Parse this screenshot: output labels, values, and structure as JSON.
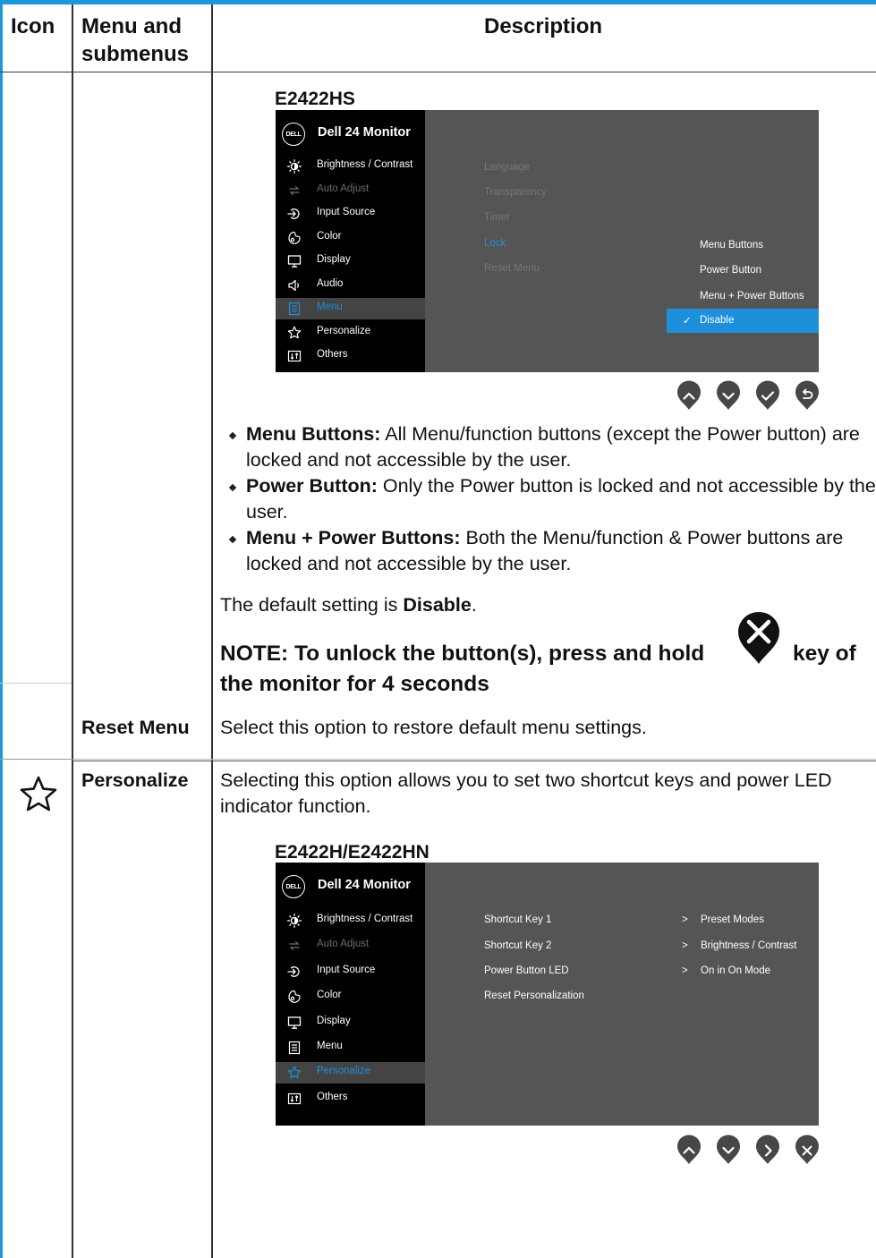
{
  "table": {
    "headers": {
      "icon": "Icon",
      "menu": "Menu and\nsubmenus",
      "description": "Description"
    }
  },
  "lock_row": {
    "osd": {
      "model_label": "E2422HS",
      "monitor_title": "Dell 24 Monitor",
      "logo_text": "DELL",
      "menu_items": [
        {
          "icon": "brightness-icon",
          "label": "Brightness / Contrast",
          "state": "normal"
        },
        {
          "icon": "auto-adjust-icon",
          "label": "Auto Adjust",
          "state": "dim"
        },
        {
          "icon": "input-source-icon",
          "label": "Input Source",
          "state": "normal"
        },
        {
          "icon": "color-icon",
          "label": "Color",
          "state": "normal"
        },
        {
          "icon": "display-icon",
          "label": "Display",
          "state": "normal"
        },
        {
          "icon": "audio-icon",
          "label": "Audio",
          "state": "normal"
        },
        {
          "icon": "menu-icon",
          "label": "Menu",
          "state": "selected"
        },
        {
          "icon": "personalize-icon",
          "label": "Personalize",
          "state": "normal"
        },
        {
          "icon": "others-icon",
          "label": "Others",
          "state": "normal"
        }
      ],
      "submenu": [
        "Language",
        "Transparency",
        "Timer",
        "Lock",
        "Reset Menu"
      ],
      "options": [
        "Menu Buttons",
        "Power Button",
        "Menu + Power Buttons",
        "Disable"
      ],
      "selected_check": "✓",
      "nav_buttons": [
        "up-icon",
        "down-icon",
        "check-icon",
        "back-icon"
      ]
    },
    "bullets": [
      {
        "term": "Menu Buttons:",
        "text": " All Menu/function buttons (except the Power button) are locked and not accessible by the user."
      },
      {
        "term": "Power Button:",
        "text": " Only the Power button is locked and not accessible by the user."
      },
      {
        "term": "Menu + Power Buttons:",
        "text": " Both the Menu/function & Power buttons are locked and not accessible by the user."
      }
    ],
    "default_prefix": "The default setting is ",
    "default_value": "Disable",
    "default_suffix": ".",
    "note_part1": "NOTE: To unlock the button(s), press and hold",
    "note_part2": "key of",
    "note_part3": "the monitor for 4 seconds"
  },
  "reset_row": {
    "menu_label": "Reset Menu",
    "description": "Select this option to restore default menu settings."
  },
  "personalize_row": {
    "icon": "star-icon",
    "menu_label": "Personalize",
    "description": "Selecting this option allows you to set two shortcut keys and power LED indicator function.",
    "osd": {
      "model_label": "E2422H/E2422HN",
      "monitor_title": "Dell 24 Monitor",
      "logo_text": "DELL",
      "menu_items": [
        {
          "icon": "brightness-icon",
          "label": "Brightness / Contrast",
          "state": "normal"
        },
        {
          "icon": "auto-adjust-icon",
          "label": "Auto Adjust",
          "state": "dim"
        },
        {
          "icon": "input-source-icon",
          "label": "Input Source",
          "state": "normal"
        },
        {
          "icon": "color-icon",
          "label": "Color",
          "state": "normal"
        },
        {
          "icon": "display-icon",
          "label": "Display",
          "state": "normal"
        },
        {
          "icon": "menu-icon",
          "label": "Menu",
          "state": "normal"
        },
        {
          "icon": "personalize-icon",
          "label": "Personalize",
          "state": "selected"
        },
        {
          "icon": "others-icon",
          "label": "Others",
          "state": "normal"
        }
      ],
      "submenu": [
        "Shortcut Key 1",
        "Shortcut Key 2",
        "Power Button LED",
        "Reset Personalization"
      ],
      "values": [
        {
          "arrow": ">",
          "label": "Preset Modes"
        },
        {
          "arrow": ">",
          "label": "Brightness / Contrast"
        },
        {
          "arrow": ">",
          "label": "On in On Mode"
        }
      ],
      "nav_buttons": [
        "up-icon",
        "down-icon",
        "right-icon",
        "close-icon"
      ]
    }
  }
}
